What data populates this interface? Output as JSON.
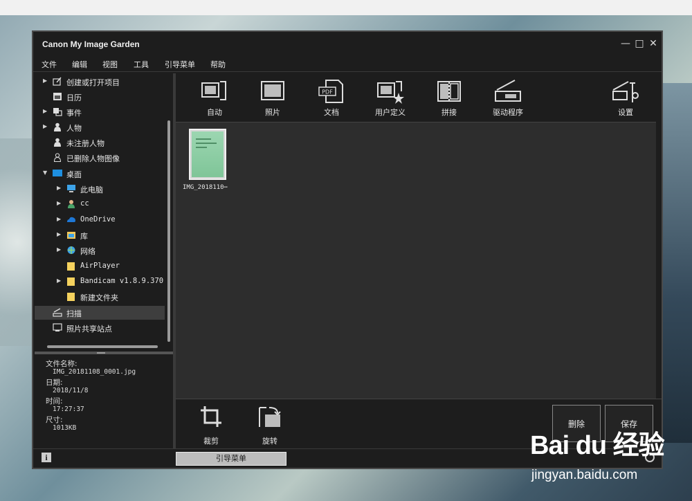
{
  "app": {
    "title": "Canon My Image Garden"
  },
  "window_controls": {
    "minimize": "—",
    "maximize": "□",
    "close": "✕"
  },
  "menu": [
    "文件",
    "编辑",
    "视图",
    "工具",
    "引导菜单",
    "帮助"
  ],
  "sidebar": {
    "items": [
      {
        "label": "创建或打开项目",
        "icon": "create-project-icon",
        "has_arrow": true
      },
      {
        "label": "日历",
        "icon": "calendar-icon",
        "has_arrow": false
      },
      {
        "label": "事件",
        "icon": "event-icon",
        "has_arrow": true
      },
      {
        "label": "人物",
        "icon": "person-icon",
        "has_arrow": true
      },
      {
        "label": "未注册人物",
        "icon": "person-icon",
        "has_arrow": false
      },
      {
        "label": "已删除人物图像",
        "icon": "person-outline-icon",
        "has_arrow": false
      },
      {
        "label": "桌面",
        "icon": "desktop-icon",
        "has_arrow": true,
        "expanded": true
      },
      {
        "label": "此电脑",
        "icon": "computer-icon",
        "has_arrow": true
      },
      {
        "label": "cc",
        "icon": "user-folder-icon",
        "has_arrow": true
      },
      {
        "label": "OneDrive",
        "icon": "cloud-icon",
        "has_arrow": true
      },
      {
        "label": "库",
        "icon": "library-icon",
        "has_arrow": true
      },
      {
        "label": "网络",
        "icon": "network-icon",
        "has_arrow": true
      },
      {
        "label": "AirPlayer",
        "icon": "folder-icon",
        "has_arrow": false
      },
      {
        "label": "Bandicam v1.8.9.370",
        "icon": "folder-icon",
        "has_arrow": true
      },
      {
        "label": "新建文件夹",
        "icon": "folder-icon",
        "has_arrow": false
      },
      {
        "label": "扫描",
        "icon": "scan-icon",
        "has_arrow": false,
        "selected": true
      },
      {
        "label": "照片共享站点",
        "icon": "photo-share-icon",
        "has_arrow": false
      }
    ]
  },
  "info": {
    "filename_label": "文件名称:",
    "filename": "IMG_20181108_0001.jpg",
    "date_label": "日期:",
    "date": "2018/11/8",
    "time_label": "时间:",
    "time": "17:27:37",
    "size_label": "尺寸:",
    "size": "1013KB"
  },
  "toolbar": {
    "auto": "自动",
    "photo": "照片",
    "document": "文档",
    "custom": "用户定义",
    "stitch": "拼接",
    "driver": "驱动程序",
    "settings": "设置",
    "pdf_badge": "PDF"
  },
  "content": {
    "thumbnail_name": "IMG_2018110⋯"
  },
  "bottom": {
    "crop": "裁剪",
    "rotate": "旋转",
    "delete": "删除",
    "save": "保存"
  },
  "status": {
    "info_glyph": "i",
    "guide_menu": "引导菜单"
  },
  "watermark": {
    "logo_text": "Bai du 经验",
    "url": "jingyan.baidu.com"
  }
}
